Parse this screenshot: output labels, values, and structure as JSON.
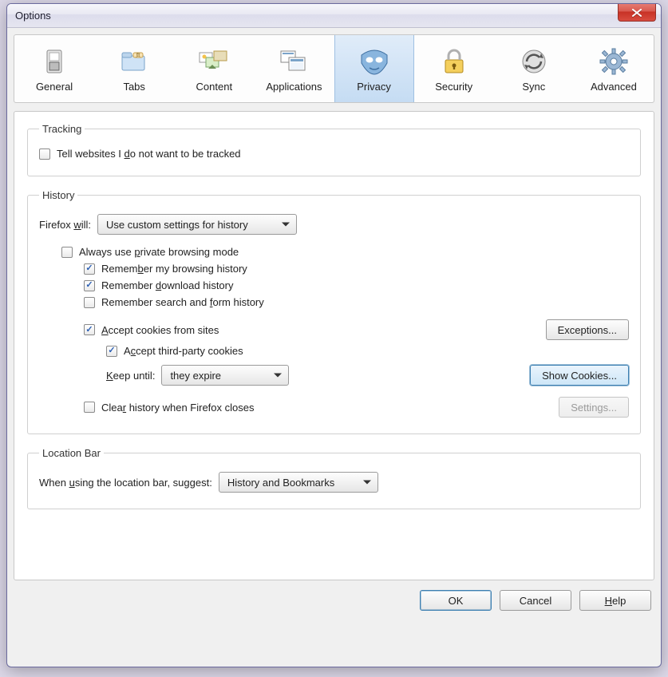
{
  "window": {
    "title": "Options"
  },
  "tabs": {
    "items": [
      {
        "label": "General"
      },
      {
        "label": "Tabs"
      },
      {
        "label": "Content"
      },
      {
        "label": "Applications"
      },
      {
        "label": "Privacy"
      },
      {
        "label": "Security"
      },
      {
        "label": "Sync"
      },
      {
        "label": "Advanced"
      }
    ],
    "selected": "Privacy"
  },
  "tracking": {
    "legend": "Tracking",
    "tell_websites": {
      "checked": false,
      "pre": "Tell websites I ",
      "ul": "d",
      "post": "o not want to be tracked"
    }
  },
  "history": {
    "legend": "History",
    "firefox_will": {
      "pre": "Firefox ",
      "ul": "w",
      "post": "ill:",
      "value": "Use custom settings for history"
    },
    "always_private": {
      "checked": false,
      "pre": "Always use ",
      "ul": "p",
      "post": "rivate browsing mode"
    },
    "remember_browsing": {
      "checked": true,
      "pre": "Remem",
      "ul": "b",
      "post": "er my browsing history"
    },
    "remember_download": {
      "checked": true,
      "pre": "Remember ",
      "ul": "d",
      "post": "ownload history"
    },
    "remember_form": {
      "checked": false,
      "pre": "Remember search and ",
      "ul": "f",
      "post": "orm history"
    },
    "accept_cookies": {
      "checked": true,
      "ul": "A",
      "post": "ccept cookies from sites"
    },
    "exceptions_btn": "Exceptions...",
    "accept_third": {
      "checked": true,
      "pre": "A",
      "ul": "c",
      "post": "cept third-party cookies"
    },
    "keep_until": {
      "ul": "K",
      "post": "eep until:",
      "value": "they expire"
    },
    "show_cookies_btn": "Show Cookies...",
    "clear_on_close": {
      "checked": false,
      "pre": "Clea",
      "ul": "r",
      "post": " history when Firefox closes"
    },
    "settings_btn": "Settings..."
  },
  "locationbar": {
    "legend": "Location Bar",
    "suggest": {
      "pre": "When ",
      "ul": "u",
      "post": "sing the location bar, suggest:",
      "value": "History and Bookmarks"
    }
  },
  "footer": {
    "ok": "OK",
    "cancel": "Cancel",
    "help": {
      "ul": "H",
      "post": "elp"
    }
  }
}
